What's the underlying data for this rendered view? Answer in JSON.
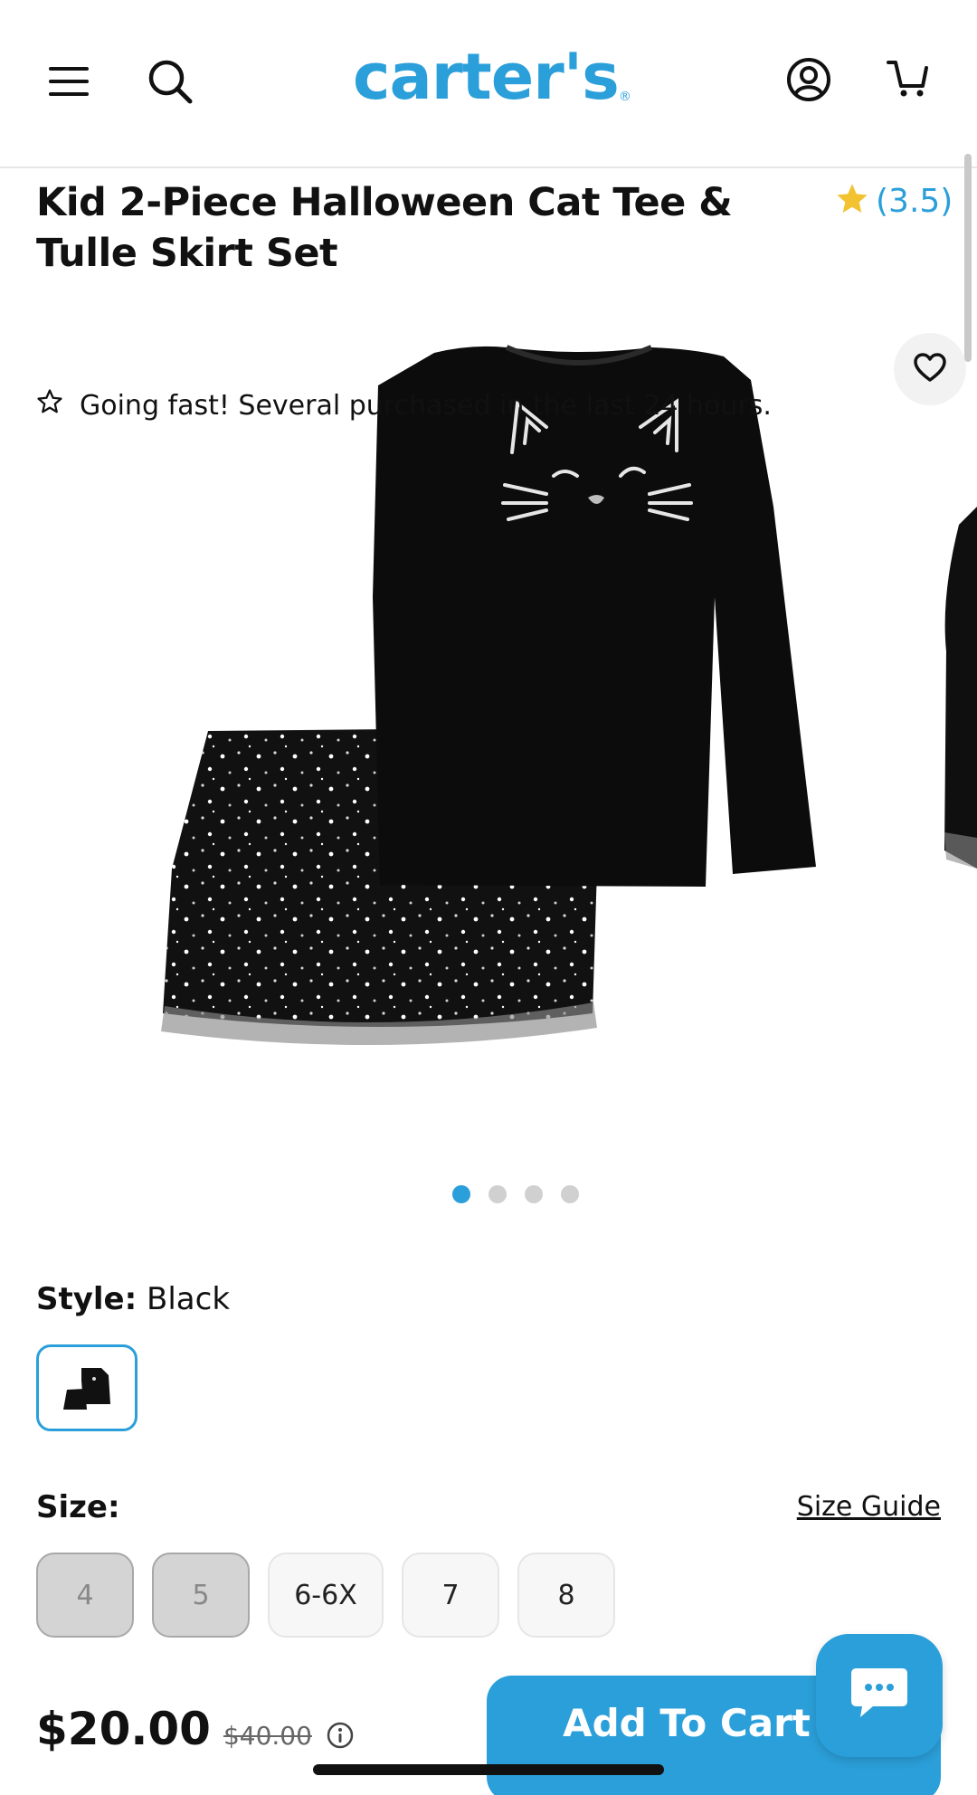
{
  "header": {
    "brand": "carter's",
    "brand_mark": "®",
    "icons": [
      "menu-icon",
      "search-icon",
      "account-icon",
      "cart-icon"
    ]
  },
  "product": {
    "title": "Kid 2-Piece Halloween Cat Tee & Tulle Skirt Set",
    "rating": "(3.5)",
    "urgency": "Going fast! Several purchased in the last 24 hours.",
    "image_count": 4,
    "active_image": 1
  },
  "style": {
    "label": "Style:",
    "value": "Black"
  },
  "size": {
    "label": "Size:",
    "guide_label": "Size Guide",
    "options": [
      {
        "label": "4",
        "available": false
      },
      {
        "label": "5",
        "available": false
      },
      {
        "label": "6-6X",
        "available": true
      },
      {
        "label": "7",
        "available": true
      },
      {
        "label": "8",
        "available": true
      }
    ]
  },
  "price": {
    "current": "$20.00",
    "original": "$40.00"
  },
  "cart": {
    "button_label": "Add To Cart"
  },
  "colors": {
    "accent": "#2b9fd9",
    "star": "#f2c230"
  }
}
